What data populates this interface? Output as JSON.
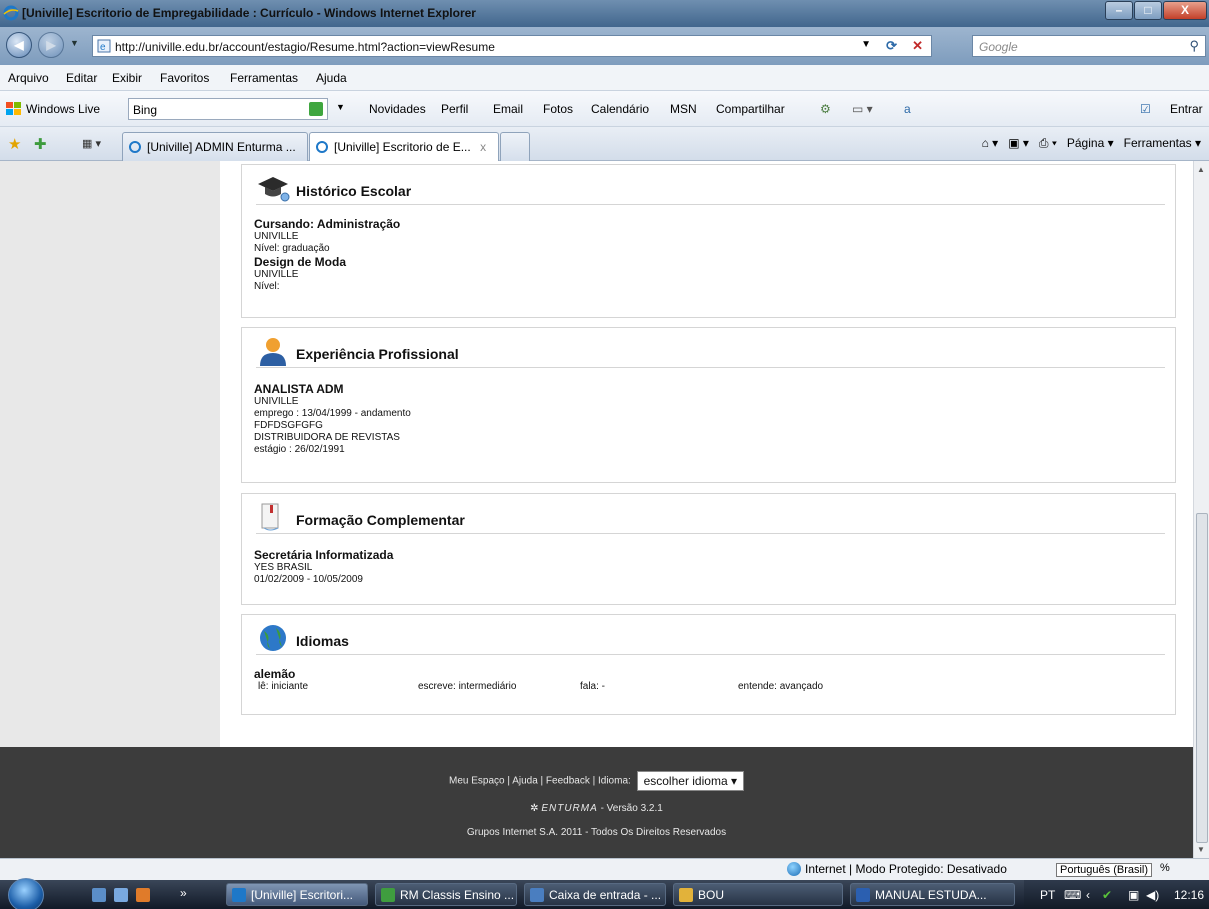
{
  "window": {
    "title": "[Univille] Escritorio de Empregabilidade : Currículo - Windows Internet Explorer",
    "buttons": {
      "minimize": "–",
      "maximize": "□",
      "close": "X"
    }
  },
  "address_bar": {
    "url": "http://univille.edu.br/account/estagio/Resume.html?action=viewResume"
  },
  "search_box": {
    "placeholder": "Google"
  },
  "menu": [
    "Arquivo",
    "Editar",
    "Exibir",
    "Favoritos",
    "Ferramentas",
    "Ajuda"
  ],
  "windows_live_bar": {
    "brand": "Windows Live",
    "search_value": "Bing",
    "links": [
      "Novidades",
      "Perfil",
      "Email",
      "Fotos",
      "Calendário",
      "MSN",
      "Compartilhar"
    ],
    "signin": "Entrar"
  },
  "tabs": [
    {
      "label": "[Univille] ADMIN Enturma ..."
    },
    {
      "label": "[Univille] Escritorio de E...",
      "close": "x"
    }
  ],
  "command_bar": {
    "page": "Página ▾",
    "tools": "Ferramentas ▾"
  },
  "resume": {
    "historico": {
      "title": "Histórico Escolar",
      "entries": [
        {
          "course": "Cursando: Administração",
          "institution": "UNIVILLE",
          "level": "Nível: graduação"
        },
        {
          "course": "Design de Moda",
          "institution": "UNIVILLE",
          "level": "Nível:"
        }
      ]
    },
    "experiencia": {
      "title": "Experiência Profissional",
      "entries": [
        {
          "role": "ANALISTA ADM",
          "company": "UNIVILLE",
          "period": "emprego : 13/04/1999 - andamento"
        },
        {
          "role": "FDFDSGFGFG",
          "company": "DISTRIBUIDORA DE REVISTAS",
          "period": "estágio : 26/02/1991"
        }
      ]
    },
    "formacao": {
      "title": "Formação Complementar",
      "course": "Secretária Informatizada",
      "institution": "YES BRASIL",
      "period": "01/02/2009 - 10/05/2009"
    },
    "idiomas": {
      "title": "Idiomas",
      "language": "alemão",
      "le": "lê: iniciante",
      "escreve": "escreve: intermediário",
      "fala": "fala: -",
      "entende": "entende: avançado"
    }
  },
  "footer": {
    "links": "Meu Espaço | Ajuda | Feedback | Idioma:",
    "language_select": "escolher idioma",
    "brand": "ENTURMA",
    "version": "- Versão 3.2.1",
    "copyright": "Grupos Internet S.A. 2011 - Todos Os Direitos Reservados"
  },
  "status_bar": {
    "zone": "Internet | Modo Protegido: Desativado",
    "tooltip": "Português (Brasil)",
    "zoom": "%"
  },
  "taskbar": {
    "tasks": [
      "[Univille] Escritori...",
      "RM Classis Ensino ...",
      "Caixa de entrada - ...",
      "BOU",
      "MANUAL ESTUDA..."
    ],
    "lang": "PT",
    "clock": "12:16"
  },
  "colors": {
    "footer_bg": "#3c3c3c",
    "left_panel": "#e8e8e8",
    "section_border": "#d5d5d5"
  }
}
